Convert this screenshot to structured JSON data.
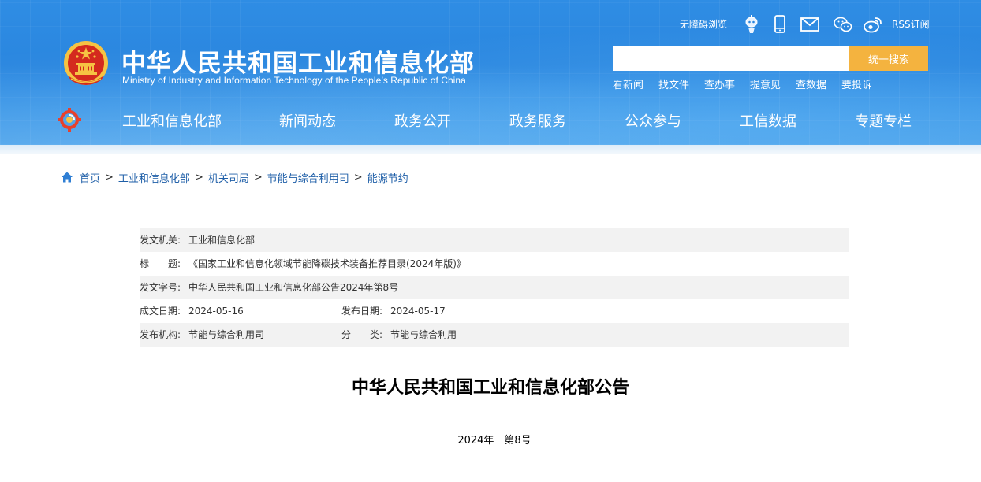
{
  "header": {
    "title": "中华人民共和国工业和信息化部",
    "subtitle": "Ministry of Industry and Information Technology of the People’s Republic of China",
    "toolbar": {
      "accessibility_label": "无障碍浏览",
      "rss_label": "RSS订阅",
      "icons": [
        "robot-icon",
        "mobile-icon",
        "mail-icon",
        "wechat-icon",
        "weibo-icon"
      ]
    },
    "search": {
      "placeholder": "",
      "button_label": "统一搜索"
    },
    "quick_links": [
      "看新闻",
      "找文件",
      "查办事",
      "提意见",
      "查数据",
      "要投诉"
    ],
    "nav": [
      "工业和信息化部",
      "新闻动态",
      "政务公开",
      "政务服务",
      "公众参与",
      "工信数据",
      "专题专栏"
    ]
  },
  "breadcrumb": {
    "items": [
      "首页",
      "工业和信息化部",
      "机关司局",
      "节能与综合利用司",
      "能源节约"
    ],
    "separator": ">"
  },
  "meta": {
    "issuer_label": "发文机关:",
    "issuer_value": "工业和信息化部",
    "title_label_1": "标",
    "title_label_2": "题:",
    "title_value": "《国家工业和信息化领域节能降碳技术装备推荐目录(2024年版)》",
    "doc_no_label": "发文字号:",
    "doc_no_value": "中华人民共和国工业和信息化部公告2024年第8号",
    "created_label": "成文日期:",
    "created_value": "2024-05-16",
    "published_label": "发布日期:",
    "published_value": "2024-05-17",
    "agency_label": "发布机构:",
    "agency_value": "节能与综合利用司",
    "category_label_1": "分",
    "category_label_2": "类:",
    "category_value": "节能与综合利用"
  },
  "document": {
    "title": "中华人民共和国工业和信息化部公告",
    "number": "2024年　第8号"
  },
  "colors": {
    "header_blue": "#2f8de4",
    "search_button": "#f4b33f",
    "link_blue": "#1f5fa8",
    "row_shade": "#f2f2f2"
  }
}
